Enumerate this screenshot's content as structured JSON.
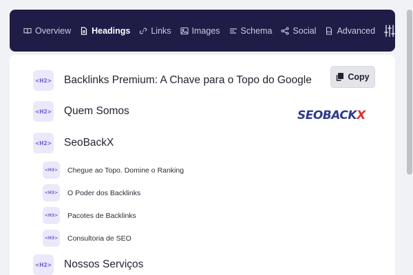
{
  "nav": {
    "tabs": [
      {
        "label": "Overview"
      },
      {
        "label": "Headings"
      },
      {
        "label": "Links"
      },
      {
        "label": "Images"
      },
      {
        "label": "Schema"
      },
      {
        "label": "Social"
      },
      {
        "label": "Advanced"
      }
    ],
    "active_tab": "Headings"
  },
  "copy_label": "Copy",
  "logo": {
    "text_main": "SEOBACK",
    "text_accent": "X"
  },
  "headings": [
    {
      "tag": "<H2>",
      "text": "Backlinks Premium: A Chave para o Topo do Google"
    },
    {
      "tag": "<H2>",
      "text": "Quem Somos"
    },
    {
      "tag": "<H2>",
      "text": "SeoBackX"
    },
    {
      "tag": "<H3>",
      "text": "Chegue ao Topo. Domine o Ranking"
    },
    {
      "tag": "<H3>",
      "text": "O Poder dos Backlinks"
    },
    {
      "tag": "<H3>",
      "text": "Pacotes de Backlinks"
    },
    {
      "tag": "<H3>",
      "text": "Consultoria de SEO"
    },
    {
      "tag": "<H2>",
      "text": "Nossos Serviços"
    }
  ],
  "colors": {
    "navbar": "#1f1d47",
    "badge_bg": "#ebe8fb",
    "badge_text": "#6d5fd0",
    "logo_blue": "#2c3a8c",
    "logo_red": "#d8322c"
  }
}
